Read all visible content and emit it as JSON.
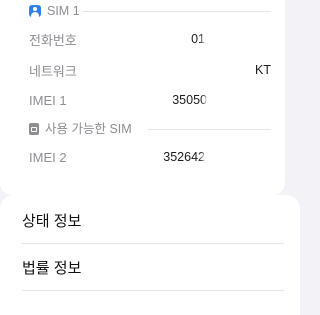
{
  "sim1": {
    "header": "SIM 1",
    "rows": [
      {
        "key": "전화번호",
        "value": "01"
      },
      {
        "key": "네트워크",
        "value": "KT"
      },
      {
        "key": "IMEI 1",
        "value": "35050"
      }
    ]
  },
  "available_sim": {
    "header": "사용 가능한 SIM",
    "rows": [
      {
        "key": "IMEI 2",
        "value": "352642"
      }
    ]
  },
  "menu": {
    "items": [
      {
        "label": "상태 정보"
      },
      {
        "label": "법률 정보"
      }
    ]
  },
  "colors": {
    "accent": "#2f80ed",
    "background": "#f2f2f7",
    "card": "#ffffff",
    "secondary_text": "#8e8e93"
  },
  "icons": {
    "sim1": "person-icon",
    "available_sim": "sim-card-icon"
  }
}
